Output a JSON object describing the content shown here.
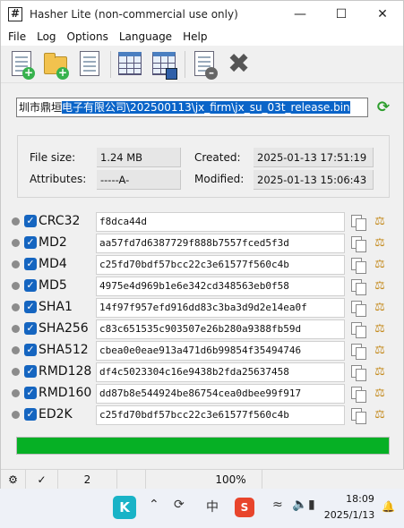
{
  "window": {
    "title": "Hasher Lite (non-commercial use only)"
  },
  "menu": [
    "File",
    "Log",
    "Options",
    "Language",
    "Help"
  ],
  "toolbar": {
    "icons": [
      "add-file-icon",
      "add-folder-icon",
      "document-icon",
      "table-icon",
      "save-table-icon",
      "remove-file-icon",
      "clear-icon"
    ]
  },
  "path": {
    "prefix": "圳市鼎垣",
    "selected": "电子有限公司\\202500113\\jx_firm\\jx_su_03t_release.bin"
  },
  "info": {
    "file_size_label": "File size:",
    "file_size": "1.24 MB",
    "attributes_label": "Attributes:",
    "attributes": "-----A-",
    "created_label": "Created:",
    "created": "2025-01-13 17:51:19",
    "modified_label": "Modified:",
    "modified": "2025-01-13 15:06:43"
  },
  "hashes": [
    {
      "name": "CRC32",
      "value": "f8dca44d"
    },
    {
      "name": "MD2",
      "value": "aa57fd7d6387729f888b7557fced5f3d"
    },
    {
      "name": "MD4",
      "value": "c25fd70bdf57bcc22c3e61577f560c4b"
    },
    {
      "name": "MD5",
      "value": "4975e4d969b1e6e342cd348563eb0f58"
    },
    {
      "name": "SHA1",
      "value": "14f97f957efd916dd83c3ba3d9d2e14ea0f"
    },
    {
      "name": "SHA256",
      "value": "c83c651535c903507e26b280a9388fb59d"
    },
    {
      "name": "SHA512",
      "value": "cbea0e0eae913a471d6b99854f35494746"
    },
    {
      "name": "RMD128",
      "value": "df4c5023304c16e9438b2fda25637458"
    },
    {
      "name": "RMD160",
      "value": "dd87b8e544924be86754cea0dbee99f917"
    },
    {
      "name": "ED2K",
      "value": "c25fd70bdf57bcc22c3e61577f560c4b"
    }
  ],
  "progress": {
    "fraction": 1.0
  },
  "status": {
    "count": "2",
    "zoom": "100%"
  },
  "taskbar": {
    "time": "18:09",
    "date": "2025/1/13",
    "ime": "中",
    "accent_colors": {
      "progress": "#06b025",
      "checkbox": "#1565c0",
      "selection": "#0a64c8"
    }
  }
}
